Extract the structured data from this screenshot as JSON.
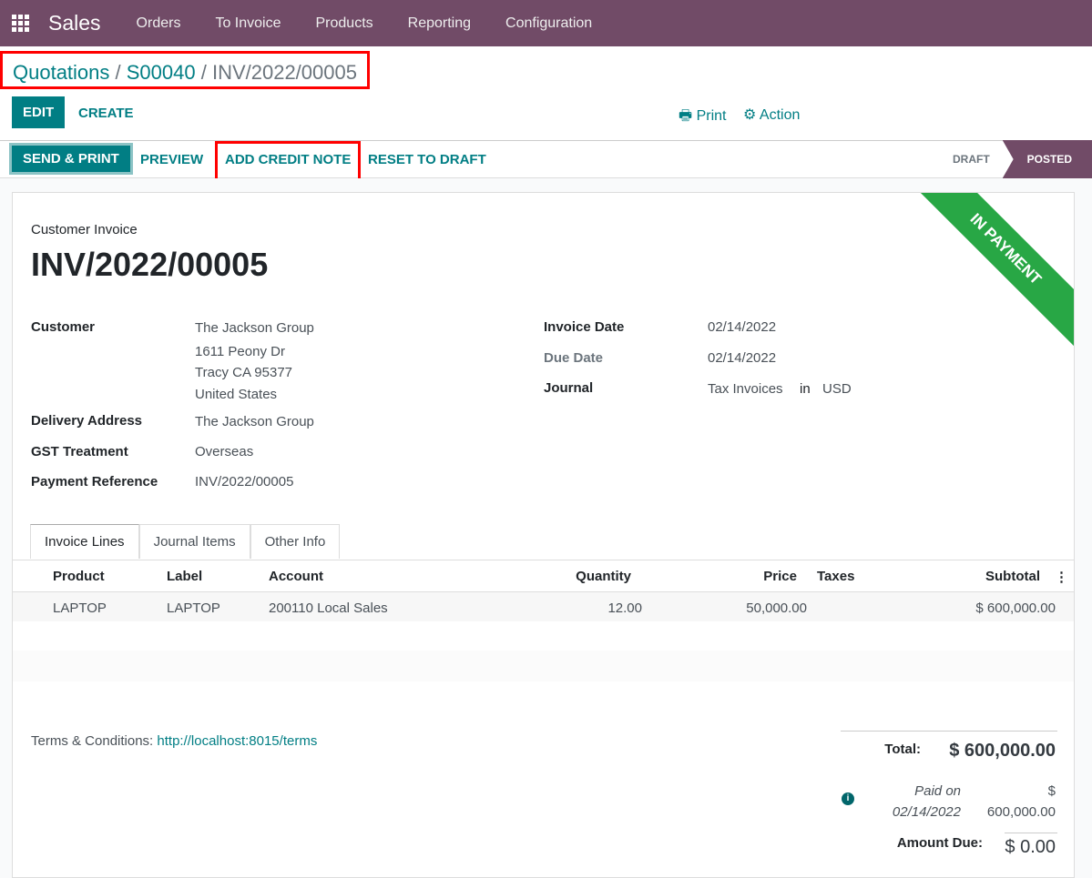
{
  "nav": {
    "app": "Sales",
    "menu": [
      "Orders",
      "To Invoice",
      "Products",
      "Reporting",
      "Configuration"
    ]
  },
  "breadcrumb": {
    "items": [
      "Quotations",
      "S00040"
    ],
    "current": "INV/2022/00005",
    "sep": " / "
  },
  "toolbar": {
    "edit": "EDIT",
    "create": "CREATE",
    "print": "Print",
    "action": "Action"
  },
  "statusbar": {
    "send_print": "SEND & PRINT",
    "preview": "PREVIEW",
    "credit_note": "ADD CREDIT NOTE",
    "reset": "RESET TO DRAFT",
    "stages": [
      "DRAFT",
      "POSTED"
    ],
    "active": "POSTED"
  },
  "sheet": {
    "ribbon": "IN PAYMENT",
    "type": "Customer Invoice",
    "number": "INV/2022/00005",
    "customer_label": "Customer",
    "customer": "The Jackson Group",
    "addr1": "1611 Peony Dr",
    "addr2": "Tracy CA 95377",
    "addr3": "United States",
    "delivery_label": "Delivery Address",
    "delivery": "The Jackson Group",
    "gst_label": "GST Treatment",
    "gst": "Overseas",
    "payref_label": "Payment Reference",
    "payref": "INV/2022/00005",
    "invdate_label": "Invoice Date",
    "invdate": "02/14/2022",
    "duedate_label": "Due Date",
    "duedate": "02/14/2022",
    "journal_label": "Journal",
    "journal": "Tax Invoices",
    "in": "in",
    "currency": "USD"
  },
  "tabs": [
    "Invoice Lines",
    "Journal Items",
    "Other Info"
  ],
  "table": {
    "headers": [
      "Product",
      "Label",
      "Account",
      "Quantity",
      "Price",
      "Taxes",
      "Subtotal"
    ],
    "rows": [
      {
        "product": "LAPTOP",
        "label": "LAPTOP",
        "account": "200110 Local Sales",
        "quantity": "12.00",
        "price": "50,000.00",
        "taxes": "",
        "subtotal": "$ 600,000.00"
      }
    ]
  },
  "terms": {
    "label": "Terms & Conditions: ",
    "link": "http://localhost:8015/terms"
  },
  "totals": {
    "total_label": "Total:",
    "total": "$ 600,000.00",
    "paid_on": "Paid on",
    "paid_date": "02/14/2022",
    "paid_cur": "$",
    "paid_amount": "600,000.00",
    "due_label": "Amount Due:",
    "due": "$ 0.00"
  }
}
